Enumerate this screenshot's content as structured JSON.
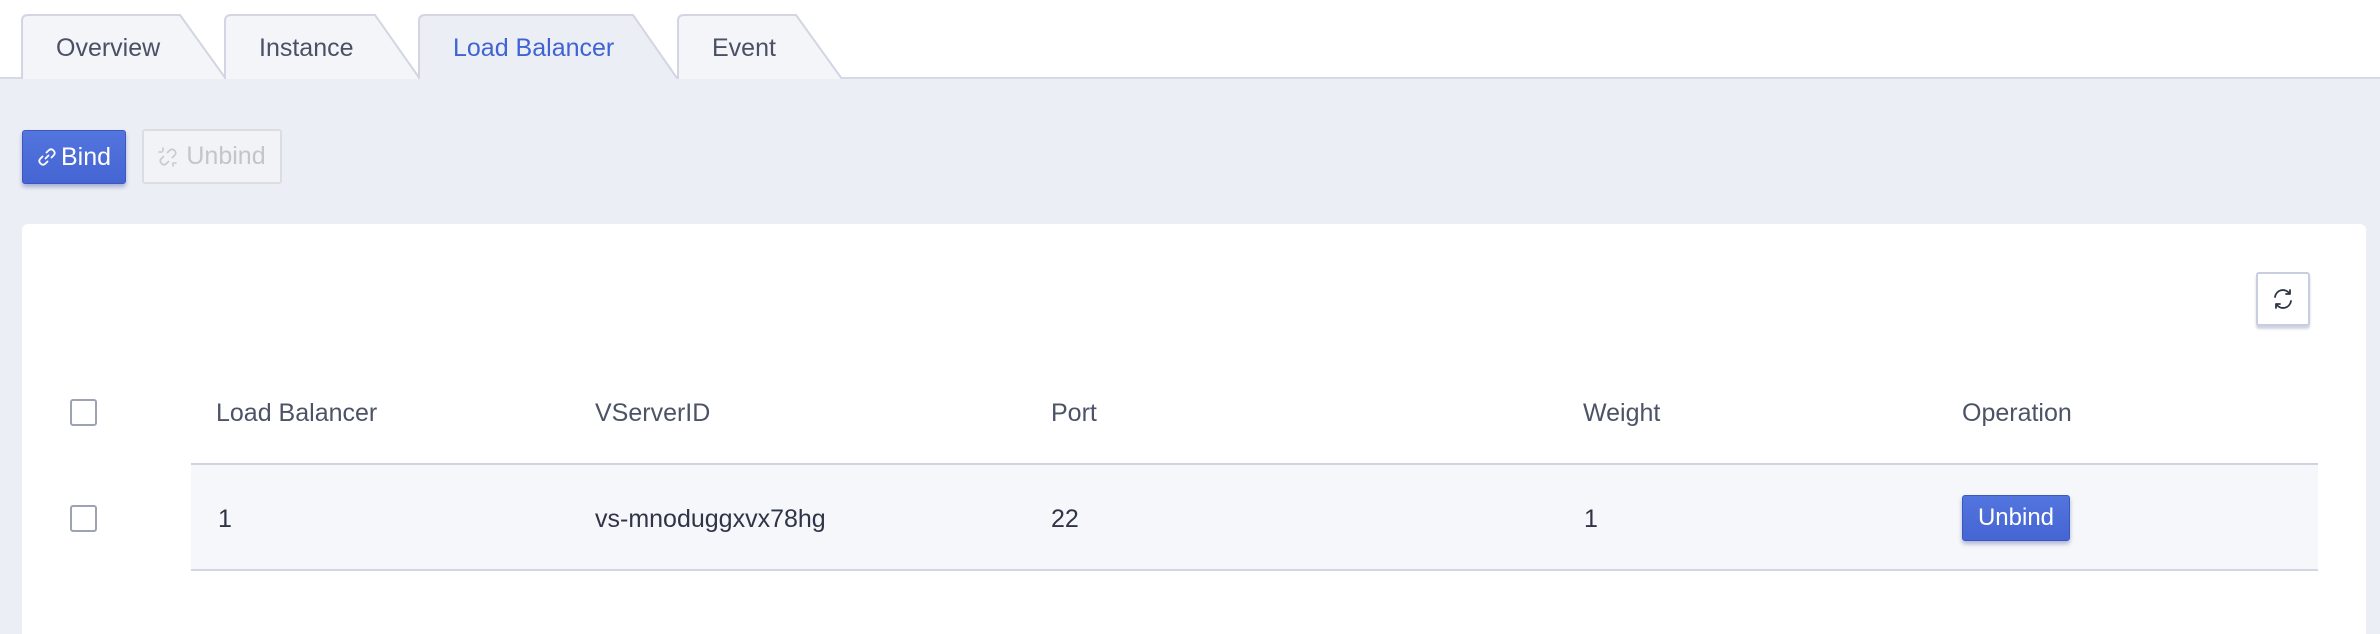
{
  "tabs": [
    {
      "label": "Overview",
      "active": false
    },
    {
      "label": "Instance",
      "active": false
    },
    {
      "label": "Load Balancer",
      "active": true
    },
    {
      "label": "Event",
      "active": false
    }
  ],
  "toolbar": {
    "bind_label": "Bind",
    "unbind_label": "Unbind",
    "bind_icon": "link-icon",
    "unbind_icon": "unlink-icon"
  },
  "table": {
    "columns": [
      "Load Balancer",
      "VServerID",
      "Port",
      "Weight",
      "Operation"
    ],
    "rows": [
      {
        "load_balancer": "1",
        "vserver_id": "vs-mnoduggxvx78hg",
        "port": "22",
        "weight": "1",
        "operation": "Unbind"
      }
    ]
  },
  "refresh_icon": "refresh-icon",
  "colors": {
    "accent": "#4a6bd9",
    "active_tab_text": "#3f63d3",
    "page_background": "#eceef6"
  }
}
